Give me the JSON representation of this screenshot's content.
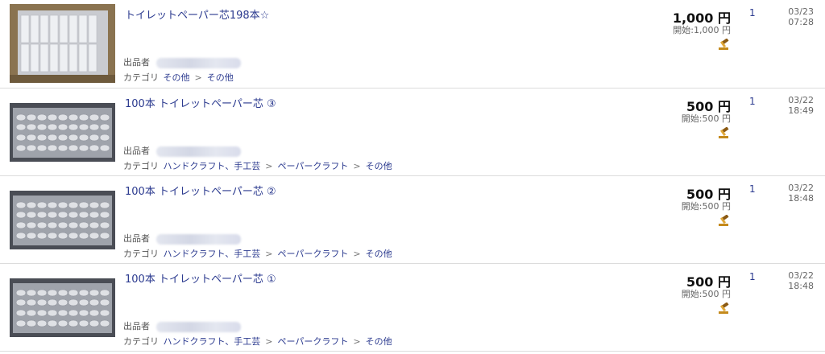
{
  "listings": [
    {
      "title": "トイレットペーパー芯198本☆",
      "seller_label": "出品者",
      "category_label": "カテゴリ",
      "categories": [
        "その他",
        "その他"
      ],
      "price": "1,000 円",
      "start_price": "開始:1,000 円",
      "bids": "1",
      "date": "03/23",
      "time": "07:28",
      "hammer_icon": "auction-hammer-icon"
    },
    {
      "title": "100本 トイレットペーパー芯 ③",
      "seller_label": "出品者",
      "category_label": "カテゴリ",
      "categories": [
        "ハンドクラフト、手工芸",
        "ペーパークラフト",
        "その他"
      ],
      "price": "500 円",
      "start_price": "開始:500 円",
      "bids": "1",
      "date": "03/22",
      "time": "18:49",
      "hammer_icon": "auction-hammer-icon"
    },
    {
      "title": "100本 トイレットペーパー芯 ②",
      "seller_label": "出品者",
      "category_label": "カテゴリ",
      "categories": [
        "ハンドクラフト、手工芸",
        "ペーパークラフト",
        "その他"
      ],
      "price": "500 円",
      "start_price": "開始:500 円",
      "bids": "1",
      "date": "03/22",
      "time": "18:48",
      "hammer_icon": "auction-hammer-icon"
    },
    {
      "title": "100本 トイレットペーパー芯 ①",
      "seller_label": "出品者",
      "category_label": "カテゴリ",
      "categories": [
        "ハンドクラフト、手工芸",
        "ペーパークラフト",
        "その他"
      ],
      "price": "500 円",
      "start_price": "開始:500 円",
      "bids": "1",
      "date": "03/22",
      "time": "18:48",
      "hammer_icon": "auction-hammer-icon"
    }
  ],
  "colors": {
    "link": "#2b3a8f",
    "divider": "#dcdcdc",
    "price": "#111111"
  }
}
